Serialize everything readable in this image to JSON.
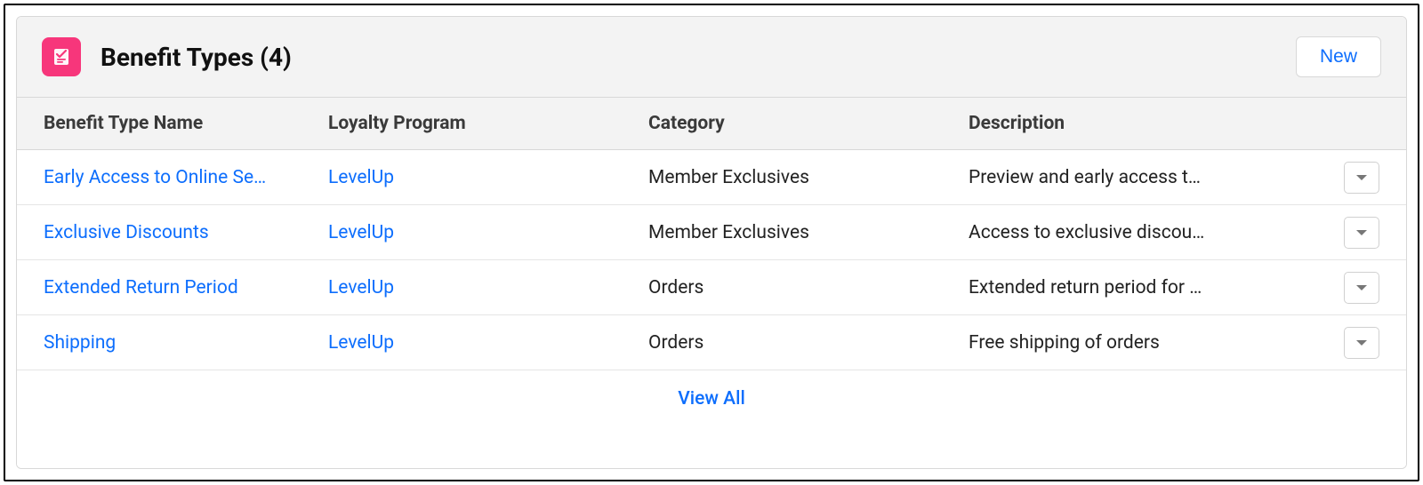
{
  "header": {
    "title": "Benefit Types (4)",
    "new_label": "New"
  },
  "columns": {
    "name": "Benefit Type Name",
    "loyalty": "Loyalty Program",
    "category": "Category",
    "description": "Description"
  },
  "rows": [
    {
      "name": "Early Access to Online Se…",
      "loyalty": "LevelUp",
      "category": "Member Exclusives",
      "description": "Preview and early access t…"
    },
    {
      "name": "Exclusive Discounts",
      "loyalty": "LevelUp",
      "category": "Member Exclusives",
      "description": "Access to exclusive discou…"
    },
    {
      "name": "Extended Return Period",
      "loyalty": "LevelUp",
      "category": "Orders",
      "description": "Extended return period for …"
    },
    {
      "name": "Shipping",
      "loyalty": "LevelUp",
      "category": "Orders",
      "description": "Free shipping of orders"
    }
  ],
  "footer": {
    "view_all": "View All"
  }
}
